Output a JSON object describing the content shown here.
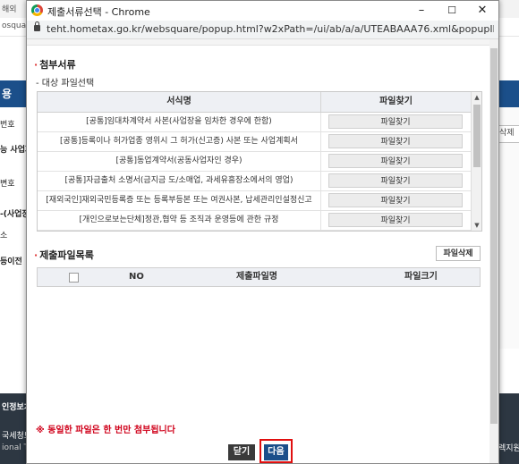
{
  "window": {
    "title": "제출서류선택 - Chrome",
    "minimize": "–",
    "maximize": "☐",
    "close": "✕",
    "url": "teht.hometax.go.kr/websquare/popup.html?w2xPath=/ui/ab/a/a/UTEABAAA76.xml&popupID=UTEABAAA76&w2..."
  },
  "background": {
    "topbar_text": "해외",
    "url_text": "osquare",
    "nav_blue": "용",
    "rows": [
      "번호",
      "능 사업자",
      "변호",
      "-(사업장",
      "소",
      "등이전"
    ],
    "right_button": "삭제",
    "footer": [
      "인정보처",
      "국세청토",
      "ional Ta",
      "렉지원"
    ]
  },
  "attach": {
    "title": "첨부서류",
    "subtitle": "- 대상 파일선택",
    "col_name": "서식명",
    "col_action": "파일찾기",
    "rows": [
      {
        "name": "[공통]임대차계약서 사본(사업장을 임차한 경우에 한함)",
        "button": "파일찾기"
      },
      {
        "name": "[공통]등록이나 허가업종 영위시 그 허가(신고증) 사본 또는 사업계획서",
        "button": "파일찾기"
      },
      {
        "name": "[공통]동업계약서(공동사업자인 경우)",
        "button": "파일찾기"
      },
      {
        "name": "[공통]자금출처 소명서(금지금 도/소매업, 과세유흥장소에서의 영업)",
        "button": "파일찾기"
      },
      {
        "name": "[재외국인]재외국민등록증 또는 등록부등본 또는 여권사본, 납세관리인설정신고",
        "button": "파일찾기"
      },
      {
        "name": "[개인으로보는단체]정관,협약 등 조직과 운영등에 관한 규정",
        "button": "파일찾기"
      }
    ]
  },
  "files": {
    "title": "제출파일목록",
    "delete_button": "파일삭제",
    "col_no": "NO",
    "col_name": "제출파일명",
    "col_size": "파일크기"
  },
  "footer": {
    "notice": "※ 동일한 파일은 한 번만 첨부됩니다",
    "close_button": "닫기",
    "next_button": "다음"
  }
}
